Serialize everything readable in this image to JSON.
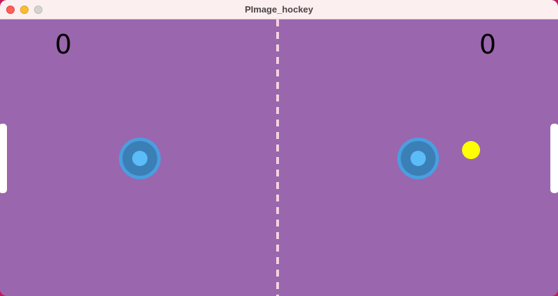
{
  "window": {
    "title": "PImage_hockey"
  },
  "scores": {
    "left": "0",
    "right": "0"
  },
  "colors": {
    "field": "#9a66ad",
    "center_line": "#f3d3e0",
    "mallet_outer": "#4a9ee0",
    "mallet_ring": "#3a7fb5",
    "mallet_knob": "#5bbcf7",
    "puck": "#ffff00",
    "goal": "#ffffff"
  }
}
